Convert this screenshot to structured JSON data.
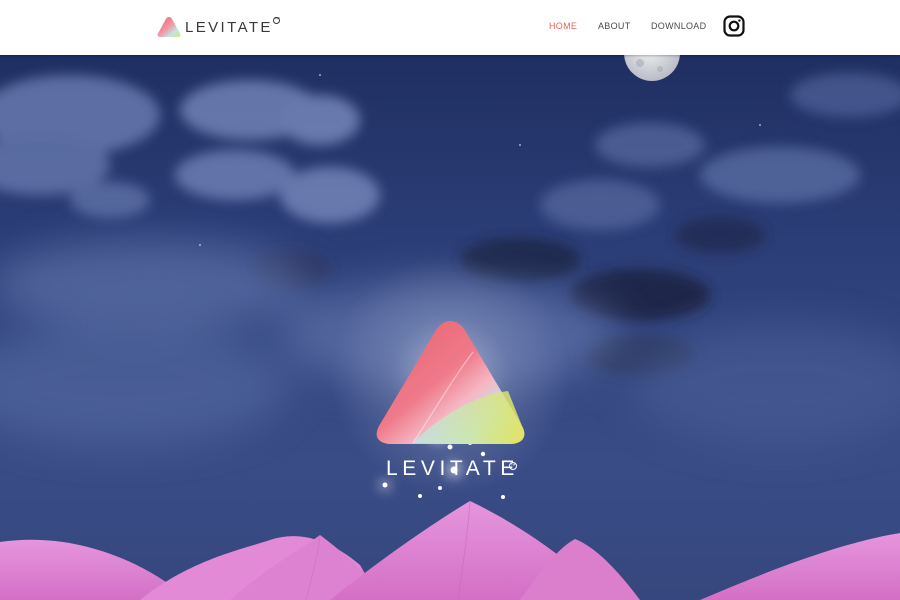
{
  "brand": {
    "name": "LEVITATE",
    "tm_symbol": "™",
    "logo_icon": "levitate-triangle-logo-icon",
    "gradient_colors": [
      "#e8606c",
      "#f49ab0",
      "#bfe6e4",
      "#dfe26a"
    ]
  },
  "nav": {
    "items": [
      {
        "label": "HOME",
        "active": true
      },
      {
        "label": "ABOUT",
        "active": false
      },
      {
        "label": "DOWNLOAD",
        "active": false
      }
    ],
    "active_color": "#e0685c",
    "social_icon": "instagram-icon"
  },
  "hero": {
    "title": "LEVITATE",
    "tm_symbol": "™",
    "sky_color": "#2e4179",
    "petal_color": "#e98ad8",
    "moon_icon": "moon-icon"
  }
}
